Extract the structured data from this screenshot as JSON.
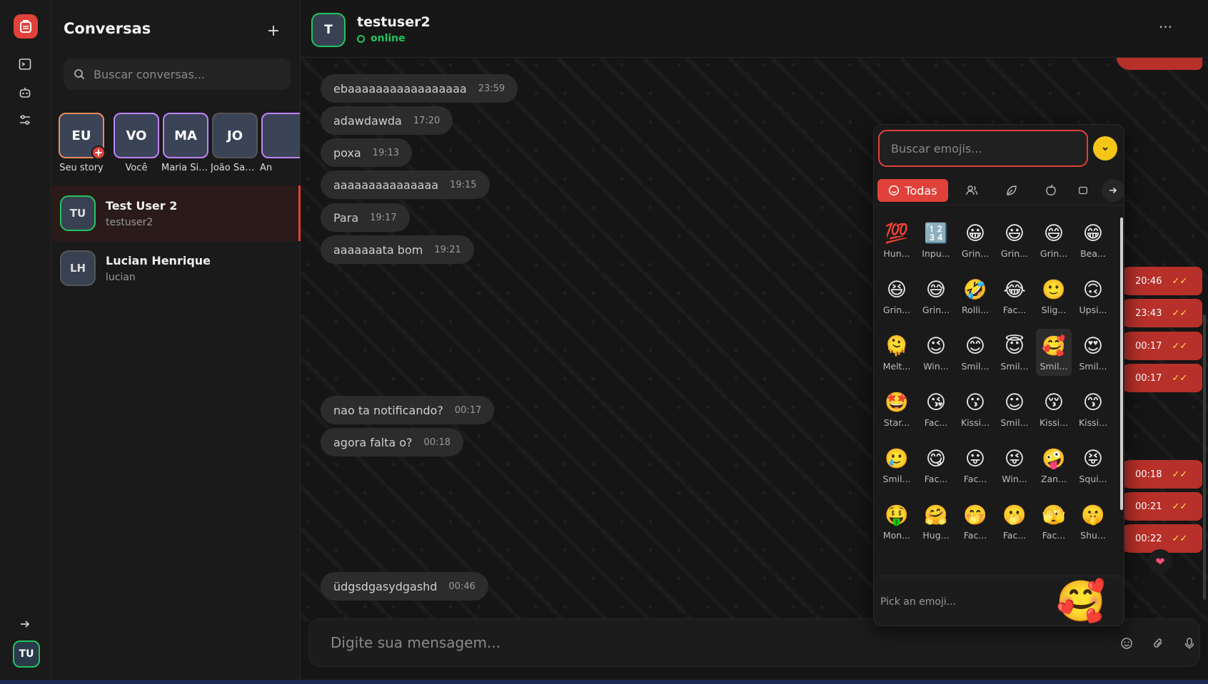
{
  "rail": {
    "icons": [
      "logo-icon",
      "terminal-icon",
      "bot-icon",
      "settings-sliders-icon"
    ],
    "expand_icon": "arrow-right-icon",
    "user_initials": "TU"
  },
  "conversations": {
    "title": "Conversas",
    "add_label": "+",
    "search_placeholder": "Buscar conversas...",
    "stories": [
      {
        "initials": "EU",
        "label": "Seu story",
        "ring": "#f08a5d",
        "add": "+"
      },
      {
        "initials": "VO",
        "label": "Você",
        "ring": "#c084fc"
      },
      {
        "initials": "MA",
        "label": "Maria Silva",
        "ring": "#c084fc"
      },
      {
        "initials": "JO",
        "label": "João Santos",
        "ring": "#555555"
      },
      {
        "initials": "",
        "label": "An",
        "ring": "#c084fc"
      }
    ],
    "items": [
      {
        "initials": "TU",
        "name": "Test User 2",
        "username": "testuser2",
        "active": true,
        "online": true
      },
      {
        "initials": "LH",
        "name": "Lucian Henrique",
        "username": "lucian",
        "active": false,
        "online": false
      }
    ]
  },
  "chat": {
    "avatar_initial": "T",
    "name": "testuser2",
    "status": "online",
    "more_label": "···",
    "received": [
      {
        "text": "ebaaaaaaaaaaaaaaaaa",
        "time": "23:59"
      },
      {
        "text": "adawdawda",
        "time": "17:20"
      },
      {
        "text": "poxa",
        "time": "19:13"
      },
      {
        "text": "aaaaaaaaaaaaaaa",
        "time": "19:15"
      },
      {
        "text": "Para",
        "time": "19:17"
      },
      {
        "text": "aaaaaaata bom",
        "time": "19:21"
      },
      {
        "text": "nao ta notificando?",
        "time": "00:17"
      },
      {
        "text": "agora falta o?",
        "time": "00:18"
      },
      {
        "text": "üdgsdgasydgashd",
        "time": "00:46"
      }
    ],
    "sent_times": [
      "20:46",
      "23:43",
      "00:17",
      "00:17",
      "00:18",
      "00:21",
      "00:22"
    ],
    "reaction": "❤",
    "compose_placeholder": "Digite sua mensagem...",
    "colors": {
      "accent": "#e0413a",
      "sent_bubble": "#b8302a",
      "online": "#22c55e"
    }
  },
  "emoji_picker": {
    "search_placeholder": "Buscar emojis...",
    "category_all": "Todas",
    "category_icons": [
      "smiley-icon",
      "people-icon",
      "leaf-icon",
      "apple-icon",
      "object-icon"
    ],
    "preview_label": "Pick an emoji...",
    "preview_emoji": "🥰",
    "emojis": [
      {
        "e": "💯",
        "n": "Hun..."
      },
      {
        "e": "🔢",
        "n": "Inpu..."
      },
      {
        "e": "😀",
        "n": "Grin..."
      },
      {
        "e": "😃",
        "n": "Grin..."
      },
      {
        "e": "😄",
        "n": "Grin..."
      },
      {
        "e": "😁",
        "n": "Bea..."
      },
      {
        "e": "😆",
        "n": "Grin..."
      },
      {
        "e": "😅",
        "n": "Grin..."
      },
      {
        "e": "🤣",
        "n": "Rolli..."
      },
      {
        "e": "😂",
        "n": "Fac..."
      },
      {
        "e": "🙂",
        "n": "Slig..."
      },
      {
        "e": "🙃",
        "n": "Upsi..."
      },
      {
        "e": "🫠",
        "n": "Melt..."
      },
      {
        "e": "😉",
        "n": "Win..."
      },
      {
        "e": "😊",
        "n": "Smil..."
      },
      {
        "e": "😇",
        "n": "Smil..."
      },
      {
        "e": "🥰",
        "n": "Smil..."
      },
      {
        "e": "😍",
        "n": "Smil..."
      },
      {
        "e": "🤩",
        "n": "Star..."
      },
      {
        "e": "😘",
        "n": "Fac..."
      },
      {
        "e": "😗",
        "n": "Kissi..."
      },
      {
        "e": "☺",
        "n": "Smil..."
      },
      {
        "e": "😚",
        "n": "Kissi..."
      },
      {
        "e": "😙",
        "n": "Kissi..."
      },
      {
        "e": "🥲",
        "n": "Smil..."
      },
      {
        "e": "😋",
        "n": "Fac..."
      },
      {
        "e": "😛",
        "n": "Fac..."
      },
      {
        "e": "😜",
        "n": "Win..."
      },
      {
        "e": "🤪",
        "n": "Zan..."
      },
      {
        "e": "😝",
        "n": "Squi..."
      },
      {
        "e": "🤑",
        "n": "Mon..."
      },
      {
        "e": "🤗",
        "n": "Hug..."
      },
      {
        "e": "🤭",
        "n": "Fac..."
      },
      {
        "e": "🫢",
        "n": "Fac..."
      },
      {
        "e": "🫣",
        "n": "Fac..."
      },
      {
        "e": "🤫",
        "n": "Shu..."
      }
    ],
    "selected_index": 16
  }
}
